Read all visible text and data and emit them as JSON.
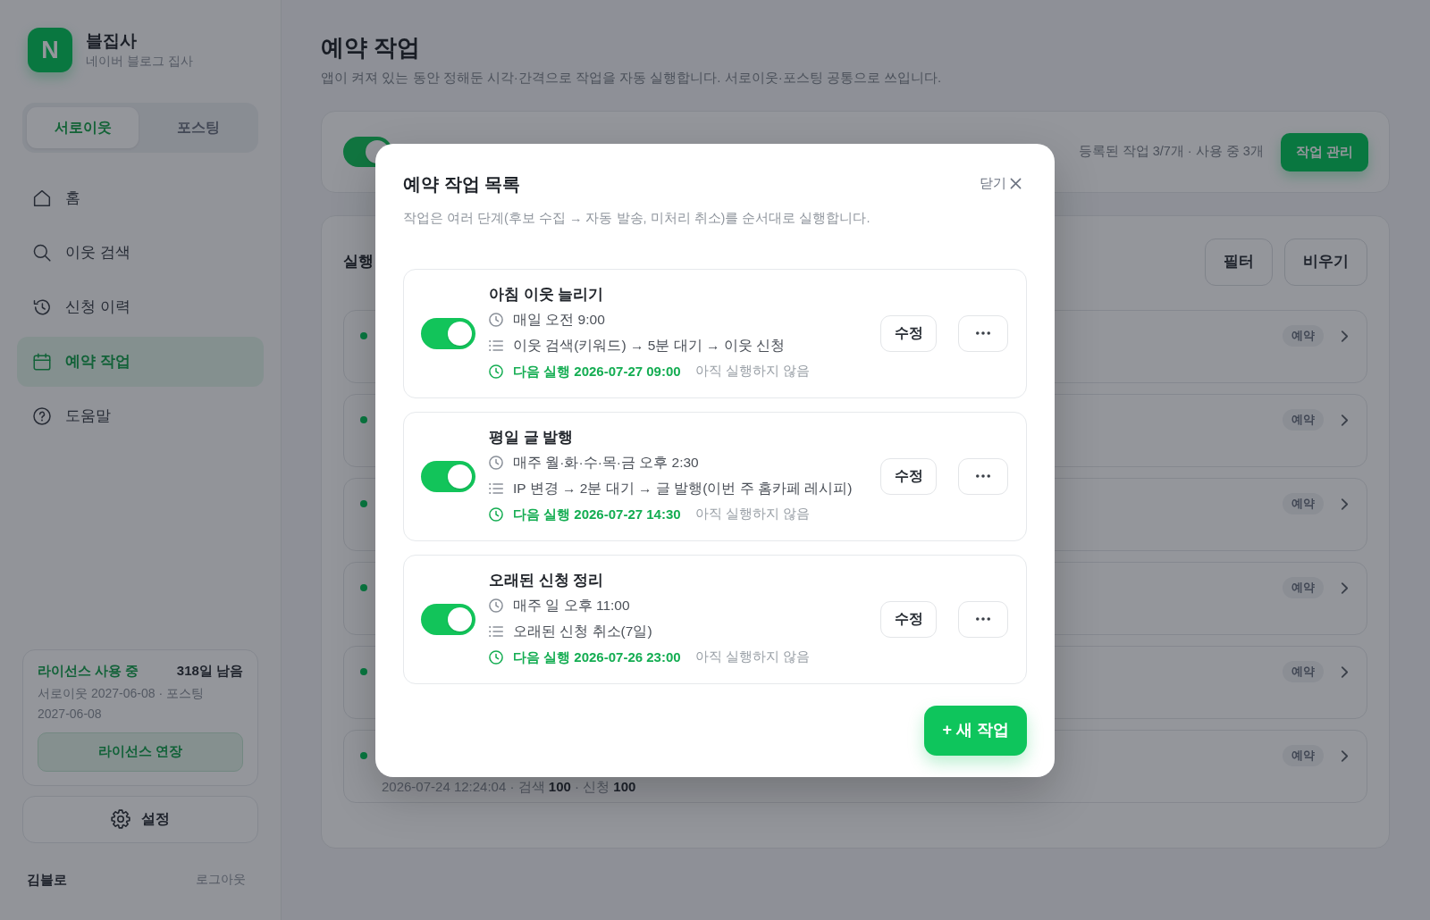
{
  "app": {
    "logo": "N",
    "name": "블집사",
    "subtitle": "네이버 블로그 집사"
  },
  "mode_tabs": [
    {
      "label": "서로이웃",
      "selected": true
    },
    {
      "label": "포스팅",
      "selected": false
    }
  ],
  "sidebar": {
    "items": [
      {
        "label": "홈",
        "selected": false
      },
      {
        "label": "이웃 검색",
        "selected": false
      },
      {
        "label": "신청 이력",
        "selected": false
      },
      {
        "label": "예약 작업",
        "selected": true
      },
      {
        "label": "도움말",
        "selected": false
      }
    ]
  },
  "license": {
    "status": "라이선스 사용 중",
    "remaining": "318일 남음",
    "dates": "서로이웃 2027-06-08 · 포스팅 2027-06-08",
    "button": "라이선스 연장"
  },
  "settings_button": "설정",
  "user": {
    "name": "김블로",
    "logout": "로그아웃"
  },
  "page": {
    "title": "예약 작업",
    "description": "앱이 켜져 있는 동안 정해둔 시각·간격으로 작업을 자동 실행합니다. 서로이웃·포스팅 공통으로 쓰입니다."
  },
  "scheduler": {
    "on": true,
    "summary": "등록된 작업 3/7개 · 사용 중 3개",
    "manage_button": "작업 관리"
  },
  "history": {
    "title": "실행",
    "buttons": [
      "필터",
      "비우기"
    ],
    "rows": [
      {
        "tag": "예약"
      },
      {
        "tag": "예약"
      },
      {
        "tag": "예약"
      },
      {
        "tag": "예약"
      },
      {
        "tag": "예약"
      },
      {
        "tag": "예약",
        "detail": "2026-07-24 12:24:04 · 검색 **100** · 신청 **100**"
      }
    ]
  },
  "dialog": {
    "title": "예약 작업 목록",
    "close": "닫기",
    "description": "작업은 여러 단계(후보 수집 → 자동 발송, 미처리 취소)를 순서대로 실행합니다.",
    "tasks": [
      {
        "name": "아침 이웃 늘리기",
        "enabled": true,
        "schedule": "매일 오전 9:00",
        "steps": "이웃 검색(키워드) → 5분 대기 → 이웃 신청",
        "next_run": "다음 실행 2026-07-27 09:00",
        "last_run": "아직 실행하지 않음",
        "edit": "수정"
      },
      {
        "name": "평일 글 발행",
        "enabled": true,
        "schedule": "매주 월·화·수·목·금 오후 2:30",
        "steps": "IP 변경 → 2분 대기 → 글 발행(이번 주 홈카페 레시피)",
        "next_run": "다음 실행 2026-07-27 14:30",
        "last_run": "아직 실행하지 않음",
        "edit": "수정"
      },
      {
        "name": "오래된 신청 정리",
        "enabled": true,
        "schedule": "매주 일 오후 11:00",
        "steps": "오래된 신청 취소(7일)",
        "next_run": "다음 실행 2026-07-26 23:00",
        "last_run": "아직 실행하지 않음",
        "edit": "수정"
      }
    ],
    "new_task_button": "+ 새 작업"
  }
}
